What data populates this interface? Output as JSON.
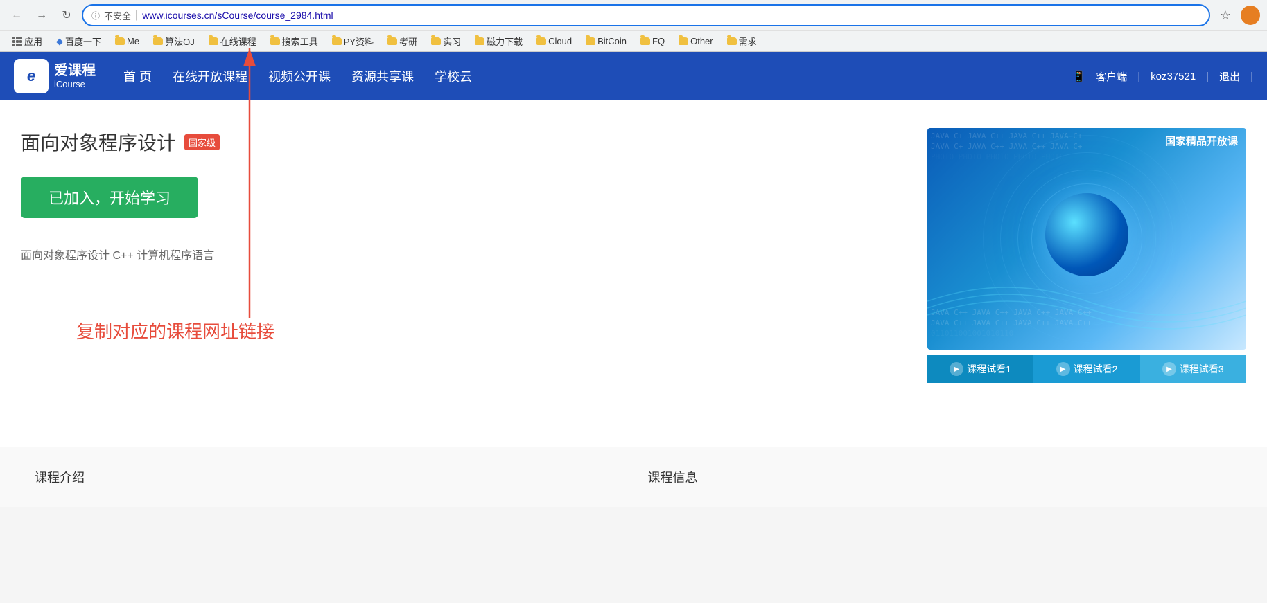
{
  "browser": {
    "back_btn": "←",
    "forward_btn": "→",
    "refresh_btn": "↻",
    "security_label": "不安全",
    "url": "www.icourses.cn/sCourse/course_2984.html",
    "star_icon": "☆",
    "bookmarks": [
      {
        "label": "应用",
        "type": "apps"
      },
      {
        "label": "百度一下",
        "type": "link"
      },
      {
        "label": "Me",
        "type": "folder"
      },
      {
        "label": "算法OJ",
        "type": "folder"
      },
      {
        "label": "在线课程",
        "type": "folder"
      },
      {
        "label": "搜索工具",
        "type": "folder"
      },
      {
        "label": "PY资料",
        "type": "folder"
      },
      {
        "label": "考研",
        "type": "folder"
      },
      {
        "label": "实习",
        "type": "folder"
      },
      {
        "label": "磁力下载",
        "type": "folder"
      },
      {
        "label": "Cloud",
        "type": "folder"
      },
      {
        "label": "BitCoin",
        "type": "folder"
      },
      {
        "label": "FQ",
        "type": "folder"
      },
      {
        "label": "Other",
        "type": "folder"
      },
      {
        "label": "需求",
        "type": "folder"
      }
    ]
  },
  "site_nav": {
    "logo_cn": "爱课程",
    "logo_en": "iCourse",
    "logo_letter": "e",
    "nav_links": [
      {
        "label": "首 页"
      },
      {
        "label": "在线开放课程"
      },
      {
        "label": "视频公开课"
      },
      {
        "label": "资源共享课"
      },
      {
        "label": "学校云"
      }
    ],
    "right_client": "客户端",
    "right_user": "koz37521",
    "right_sep": "|",
    "right_logout": "退出"
  },
  "course": {
    "title": "面向对象程序设计",
    "badge": "国家级",
    "join_btn": "已加入，开始学习",
    "description": "面向对象程序设计 C++ 计算机程序语言",
    "annotation": "复制对应的课程网址链接",
    "image_overlay": "国家精品开放课",
    "preview_btns": [
      {
        "label": "课程试看1"
      },
      {
        "label": "课程试看2"
      },
      {
        "label": "课程试看3"
      }
    ]
  },
  "footer": {
    "section1_title": "课程介绍",
    "section2_title": "课程信息"
  },
  "colors": {
    "nav_bg": "#1e4db7",
    "join_btn": "#27ae60",
    "badge": "#e74c3c",
    "arrow": "#e74c3c",
    "preview_btn": "#1a9bd4"
  }
}
